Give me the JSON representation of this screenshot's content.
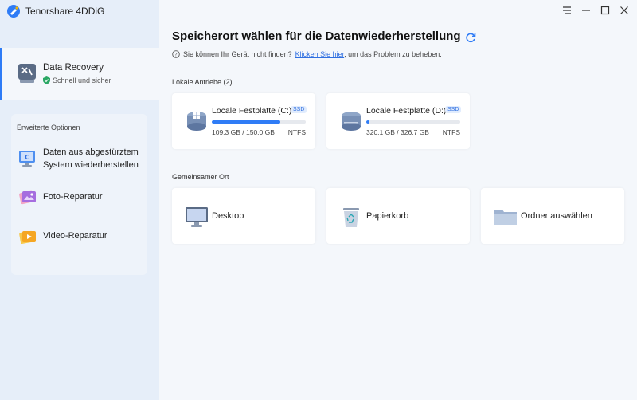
{
  "app": {
    "name": "Tenorshare 4DDiG"
  },
  "sidebar": {
    "active": {
      "title": "Data Recovery",
      "subtitle": "Schnell und sicher"
    },
    "advanced": {
      "heading": "Erweiterte Optionen",
      "items": [
        {
          "line1": "Daten aus abgestürztem",
          "line2": "System wiederherstellen"
        },
        {
          "label": "Foto-Reparatur"
        },
        {
          "label": "Video-Reparatur"
        }
      ]
    }
  },
  "main": {
    "title": "Speicherort wählen für die Datenwiederherstellung",
    "help": {
      "prefix": "Sie können Ihr Gerät nicht finden?",
      "link": "Klicken Sie hier",
      "suffix": ", um das Problem zu beheben."
    },
    "local_section": "Lokale Antriebe (2)",
    "drives": [
      {
        "name": "Locale Festplatte (C:)",
        "badge": "SSD",
        "size": "109.3 GB / 150.0 GB",
        "fs": "NTFS",
        "used_fraction": 0.73
      },
      {
        "name": "Locale Festplatte (D:)",
        "badge": "SSD",
        "size": "320.1 GB / 326.7 GB",
        "fs": "NTFS",
        "used_fraction": 0.02
      }
    ],
    "shared_section": "Gemeinsamer Ort",
    "locations": [
      {
        "label": "Desktop"
      },
      {
        "label": "Papierkorb"
      },
      {
        "label": "Ordner auswählen"
      }
    ]
  },
  "colors": {
    "accent": "#2f7cf6",
    "link": "#2f6fe0",
    "sidebar_bg": "#e6eef9",
    "main_bg": "#f4f7fb"
  }
}
